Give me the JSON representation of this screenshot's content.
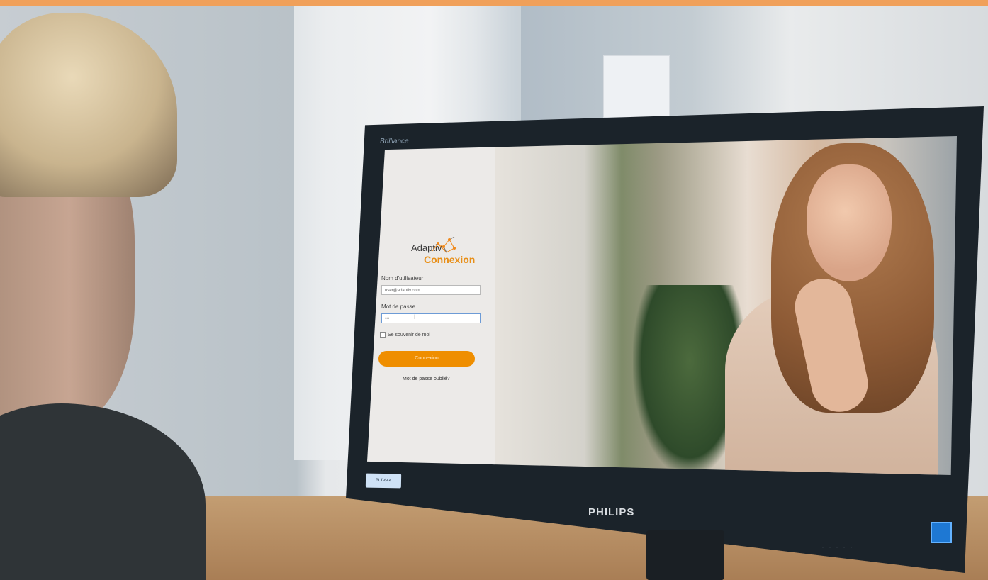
{
  "colors": {
    "top_bar": "#f0a05a",
    "accent": "#ef8e00",
    "title_orange": "#e88f18",
    "monitor_frame": "#1b232a",
    "led_blue": "#1e78d3"
  },
  "monitor": {
    "brand_label": "Brilliance",
    "brand_suffix": "",
    "logo": "PHILIPS",
    "asset_tag": "PLT-644"
  },
  "login": {
    "logo_text": "Adaptiv",
    "title": "Connexion",
    "username_label": "Nom d'utilisateur",
    "username_value": "user@adaptiv.com",
    "password_label": "Mot de passe",
    "password_value": "•••",
    "remember_label": "Se souvenir de moi",
    "submit_label": "Connexion",
    "forgot_label": "Mot de passe oublié?"
  }
}
